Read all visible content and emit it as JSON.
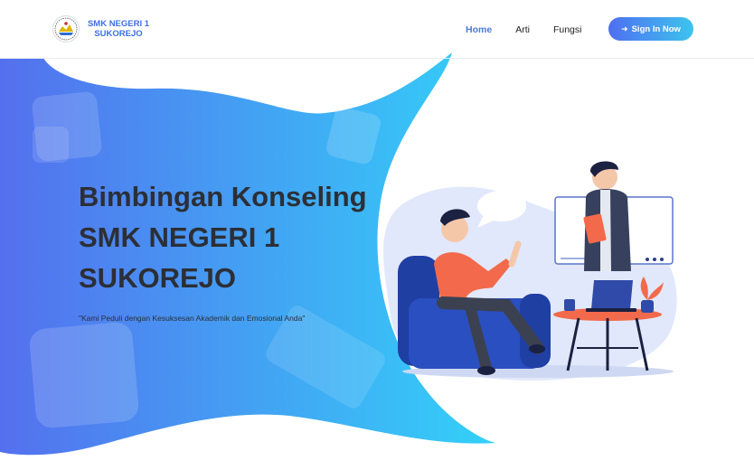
{
  "brand": {
    "line1": "SMK NEGERI 1",
    "line2": "SUKOREJO",
    "logo_icon": "school-emblem-icon"
  },
  "nav": {
    "items": [
      {
        "label": "Home",
        "active": true
      },
      {
        "label": "Arti",
        "active": false
      },
      {
        "label": "Fungsi",
        "active": false
      }
    ],
    "signin_label": "Sign In Now",
    "signin_icon": "sign-in-icon"
  },
  "hero": {
    "title_lines": [
      "Bimbingan Konseling",
      "SMK NEGERI 1",
      "SUKOREJO"
    ],
    "subtitle": "\"Kami Peduli dengan Kesuksesan Akademik dan Emosional Anda\""
  },
  "colors": {
    "gradient_start": "#5470ee",
    "gradient_end": "#33d1f8",
    "active_link": "#4a7ad8",
    "text_dark": "#2c2f36"
  }
}
